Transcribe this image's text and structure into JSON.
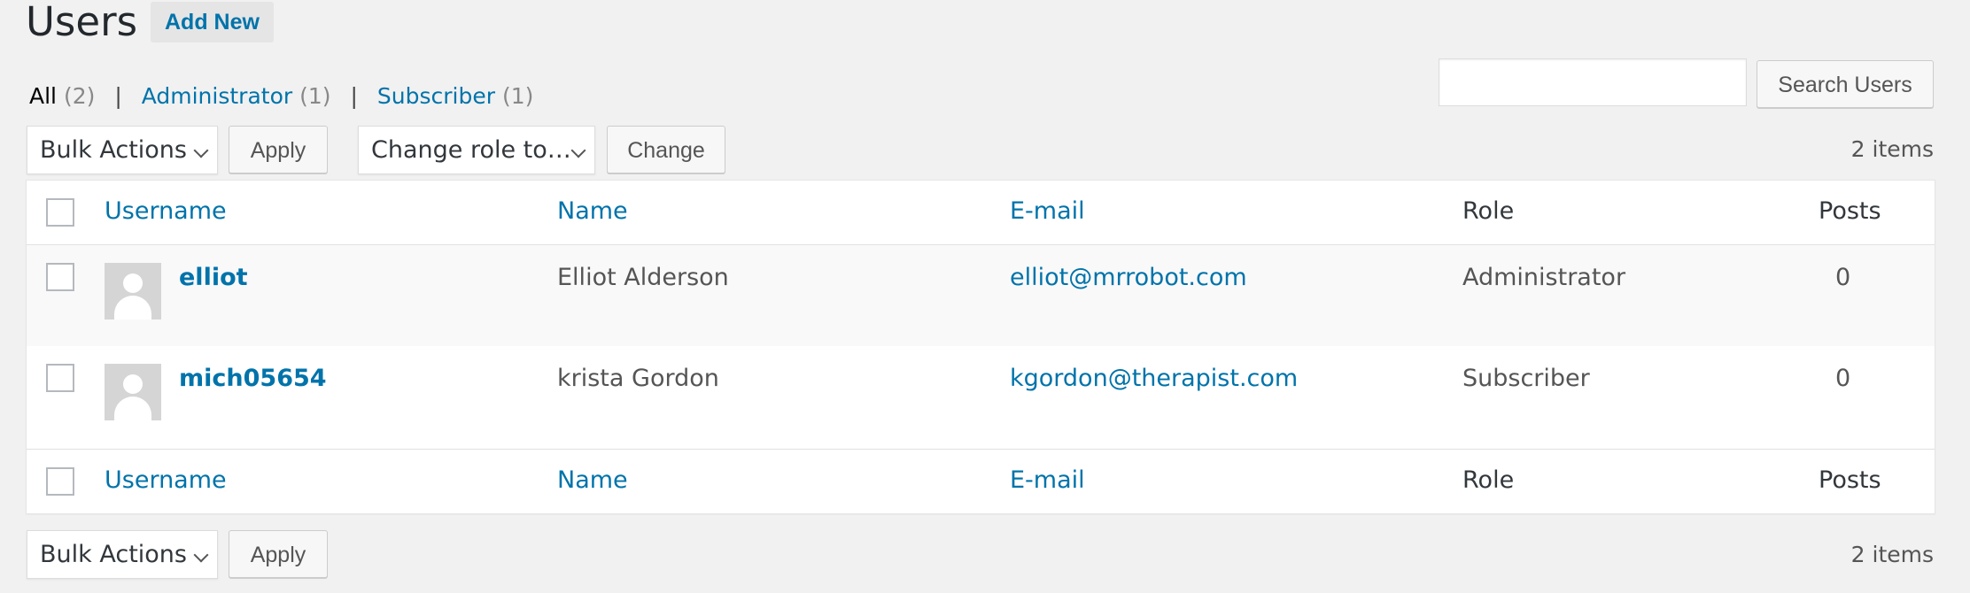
{
  "header": {
    "title": "Users",
    "add_new": "Add New"
  },
  "filters": {
    "all": "All",
    "all_count": "(2)",
    "administrator": "Administrator",
    "administrator_count": "(1)",
    "subscriber": "Subscriber",
    "subscriber_count": "(1)",
    "separator": "|"
  },
  "search": {
    "value": "",
    "placeholder": "",
    "button": "Search Users"
  },
  "top_actions": {
    "bulk_actions": "Bulk Actions",
    "apply": "Apply",
    "change_role": "Change role to…",
    "change": "Change",
    "items_count": "2 items"
  },
  "bottom_actions": {
    "bulk_actions": "Bulk Actions",
    "apply": "Apply",
    "items_count": "2 items"
  },
  "table": {
    "columns": {
      "username": "Username",
      "name": "Name",
      "email": "E-mail",
      "role": "Role",
      "posts": "Posts"
    },
    "rows": [
      {
        "username": "elliot",
        "name": "Elliot Alderson",
        "email": "elliot@mrrobot.com",
        "role": "Administrator",
        "posts": "0"
      },
      {
        "username": "mich05654",
        "name": "krista Gordon",
        "email": "kgordon@therapist.com",
        "role": "Subscriber",
        "posts": "0"
      }
    ]
  },
  "icons": {
    "dropdown": "chevron-down-icon",
    "avatar": "default-user-avatar-icon"
  },
  "colors": {
    "background": "#f1f1f1",
    "link": "#0073aa",
    "table_background": "#ffffff",
    "row_alt": "#f9f9f9",
    "border": "#e5e5e5"
  }
}
